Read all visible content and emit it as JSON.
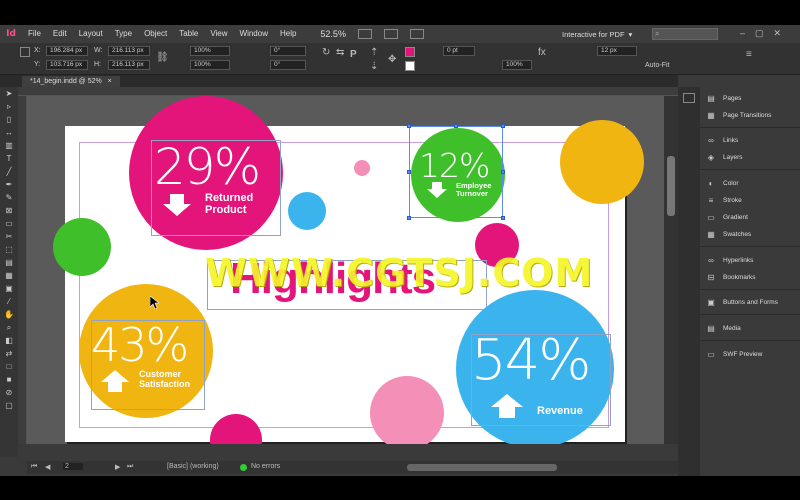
{
  "menu": {
    "logo": "Id",
    "items": [
      "File",
      "Edit",
      "Layout",
      "Type",
      "Object",
      "Table",
      "View",
      "Window",
      "Help"
    ],
    "zoom": "52.5%",
    "workspace": "Interactive for PDF"
  },
  "control": {
    "x_label": "X:",
    "x_value": "196.284 px",
    "y_label": "Y:",
    "y_value": "103.716 px",
    "w_label": "W:",
    "w_value": "216.113 px",
    "h_label": "H:",
    "h_value": "216.113 px",
    "scale_x": "100%",
    "scale_y": "100%",
    "rotate": "0°",
    "shear": "0°",
    "stroke_weight": "0 pt",
    "opacity": "100%",
    "ref_size": "12 px",
    "auto_fit": "Auto-Fit"
  },
  "document": {
    "tab_label": "*14_begin.indd @ 52%"
  },
  "status": {
    "page": "2",
    "style": "[Basic] (working)",
    "preflight": "No errors"
  },
  "panels": [
    {
      "label": "Pages",
      "icon": "pages-icon",
      "glyph": "▤"
    },
    {
      "label": "Page Transitions",
      "icon": "page-transitions-icon",
      "glyph": "▦"
    },
    {
      "label": "Links",
      "icon": "links-icon",
      "glyph": "∞"
    },
    {
      "label": "Layers",
      "icon": "layers-icon",
      "glyph": "◈"
    },
    {
      "label": "Color",
      "icon": "color-icon",
      "glyph": "◐"
    },
    {
      "label": "Stroke",
      "icon": "stroke-icon",
      "glyph": "≡"
    },
    {
      "label": "Gradient",
      "icon": "gradient-icon",
      "glyph": "▭"
    },
    {
      "label": "Swatches",
      "icon": "swatches-icon",
      "glyph": "▦"
    },
    {
      "label": "Hyperlinks",
      "icon": "hyperlinks-icon",
      "glyph": "∞"
    },
    {
      "label": "Bookmarks",
      "icon": "bookmarks-icon",
      "glyph": "⊟"
    },
    {
      "label": "Buttons and Forms",
      "icon": "buttons-forms-icon",
      "glyph": "▣"
    },
    {
      "label": "Media",
      "icon": "media-icon",
      "glyph": "▤"
    },
    {
      "label": "SWF Preview",
      "icon": "swf-preview-icon",
      "glyph": "▭"
    }
  ],
  "infographic": {
    "stat1": {
      "value": "29%",
      "label_line1": "Returned",
      "label_line2": "Product"
    },
    "stat2": {
      "value": "12%",
      "label_line1": "Employee",
      "label_line2": "Turnover"
    },
    "stat3": {
      "value": "43%",
      "label_line1": "Customer",
      "label_line2": "Satisfaction"
    },
    "stat4": {
      "value": "54%",
      "label_line1": "Revenue"
    },
    "heading": "Highlights",
    "watermark": "WWW.CGTSJ.COM",
    "colors": {
      "pink": "#e4157a",
      "green": "#3fbf2a",
      "yellow": "#f1b512",
      "blue": "#3bb4ee",
      "light_pink": "#f48fb8"
    }
  }
}
